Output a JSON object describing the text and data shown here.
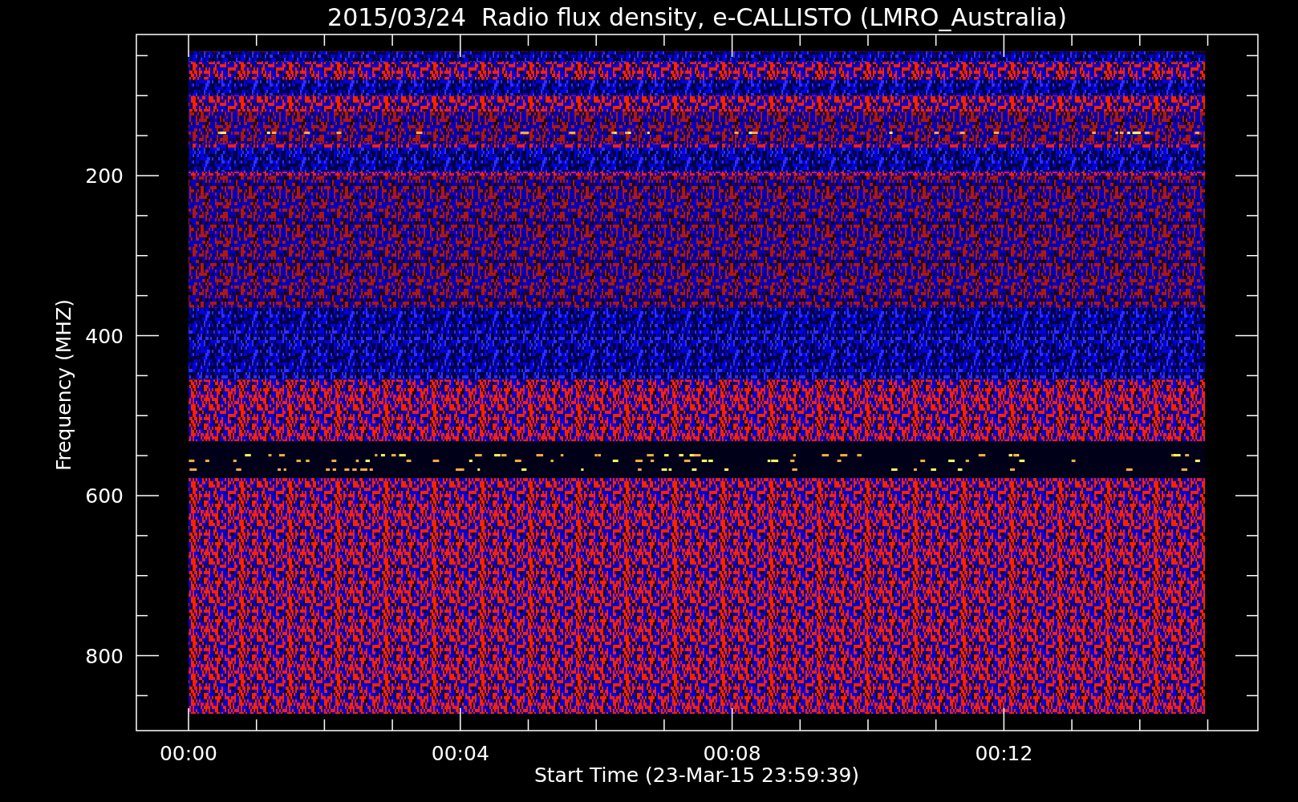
{
  "title": "2015/03/24  Radio flux density, e-CALLISTO (LMRO_Australia)",
  "y_axis": {
    "label": "Frequency (MHZ)",
    "ticks": [
      "200",
      "400",
      "600",
      "800"
    ]
  },
  "x_axis": {
    "label": "Start Time (23-Mar-15 23:59:39)",
    "ticks": [
      "00:00",
      "00:04",
      "00:08",
      "00:12"
    ]
  }
}
